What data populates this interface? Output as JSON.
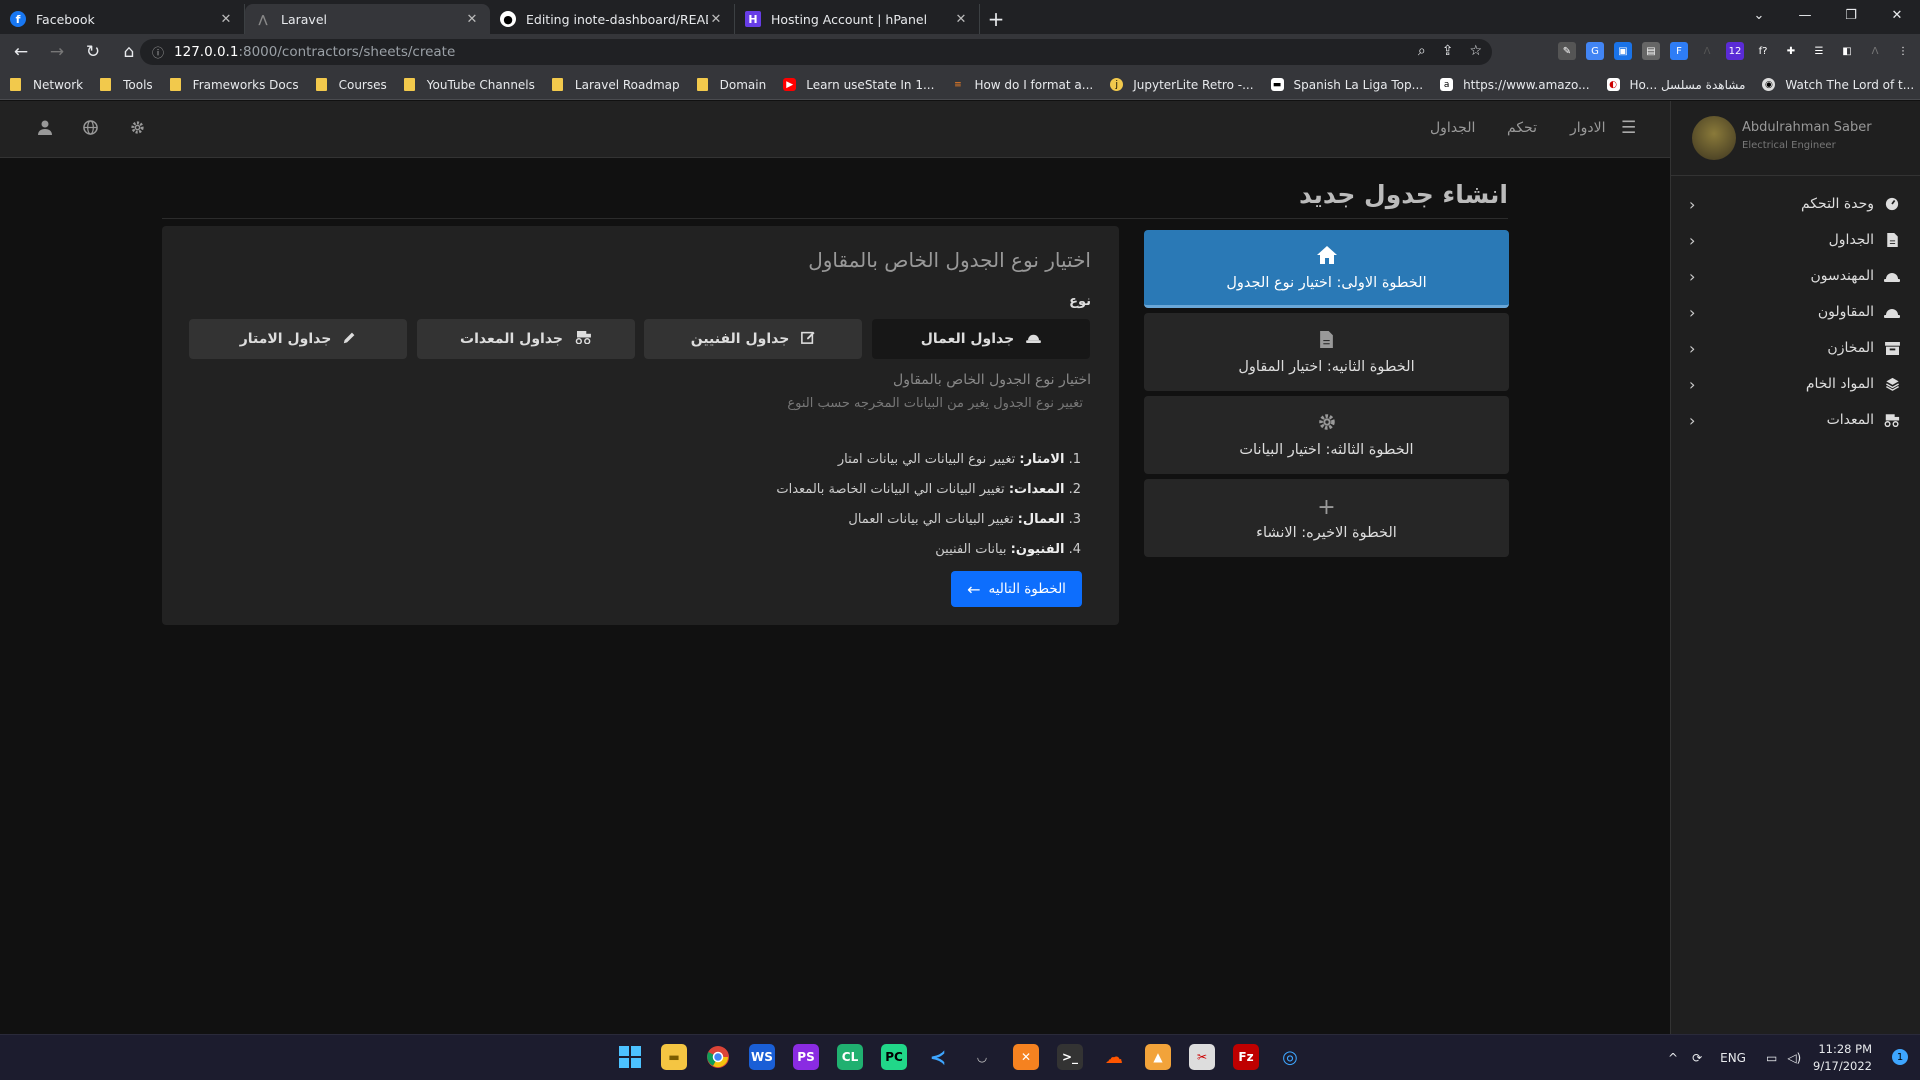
{
  "browser": {
    "tabs": [
      {
        "title": "Facebook",
        "icon": "facebook-icon",
        "color": "#1877f2"
      },
      {
        "title": "Laravel",
        "icon": "laravel-icon",
        "color": "#35363a"
      },
      {
        "title": "Editing inote-dashboard/READM",
        "icon": "github-icon",
        "color": "#ffffff"
      },
      {
        "title": "Hosting Account | hPanel",
        "icon": "hostinger-icon",
        "color": "#673de6"
      }
    ],
    "url_host": "127.0.0.1",
    "url_path": ":8000/contractors/sheets/create",
    "bookmarks": [
      {
        "label": "Network",
        "type": "folder"
      },
      {
        "label": "Tools",
        "type": "folder"
      },
      {
        "label": "Frameworks Docs",
        "type": "folder"
      },
      {
        "label": "Courses",
        "type": "folder"
      },
      {
        "label": "YouTube Channels",
        "type": "folder"
      },
      {
        "label": "Laravel Roadmap",
        "type": "folder"
      },
      {
        "label": "Domain",
        "type": "folder"
      },
      {
        "label": "Learn useState In 1...",
        "type": "youtube"
      },
      {
        "label": "How do I format a...",
        "type": "stackoverflow"
      },
      {
        "label": "JupyterLite Retro -...",
        "type": "jupyter"
      },
      {
        "label": "Spanish La Liga Top...",
        "type": "site"
      },
      {
        "label": "https://www.amazo...",
        "type": "amazon"
      },
      {
        "label": "Ho... مشاهدة مسلسل",
        "type": "site2"
      },
      {
        "label": "Watch The Lord of t...",
        "type": "site3"
      }
    ]
  },
  "header": {
    "nav": [
      "الادوار",
      "تحكم",
      "الجداول"
    ]
  },
  "sidebar": {
    "user_name": "Abdulrahman Saber",
    "user_role": "Electrical Engineer",
    "items": [
      {
        "label": "وحدة التحكم",
        "icon": "dashboard-icon"
      },
      {
        "label": "الجداول",
        "icon": "file-icon"
      },
      {
        "label": "المهندسون",
        "icon": "helmet-icon"
      },
      {
        "label": "المقاولون",
        "icon": "helmet-icon"
      },
      {
        "label": "المخازن",
        "icon": "warehouse-icon"
      },
      {
        "label": "المواد الخام",
        "icon": "layers-icon"
      },
      {
        "label": "المعدات",
        "icon": "truck-icon"
      }
    ]
  },
  "page": {
    "title": "انشاء جدول جديد",
    "steps": [
      {
        "label": "الخطوة الاولى: اختيار نوع الجدول",
        "icon": "home-icon",
        "active": true
      },
      {
        "label": "الخطوة الثانيه: اختيار المقاول",
        "icon": "file-icon",
        "active": false
      },
      {
        "label": "الخطوة الثالثه: اختيار البيانات",
        "icon": "gear-icon",
        "active": false
      },
      {
        "label": "الخطوة الاخيره: الانشاء",
        "icon": "plus-icon",
        "active": false
      }
    ],
    "card_title": "اختيار نوع الجدول الخاص بالمقاول",
    "type_label": "نوع",
    "type_buttons": [
      {
        "label": "جداول العمال",
        "icon": "helmet-icon",
        "selected": true
      },
      {
        "label": "جداول الفنيين",
        "icon": "edit-icon",
        "selected": false
      },
      {
        "label": "جداول المعدات",
        "icon": "truck-icon",
        "selected": false
      },
      {
        "label": "جداول الامتار",
        "icon": "pencil-icon",
        "selected": false
      }
    ],
    "desc_title": "اختيار نوع الجدول الخاص بالمقاول",
    "desc_sub": "تغيير نوع الجدول يغير من البيانات المخرجه حسب النوع",
    "list": [
      {
        "num": "1.",
        "term": "الامتار:",
        "text": "تغيير نوع البيانات الي بيانات امتار"
      },
      {
        "num": "2.",
        "term": "المعدات:",
        "text": "تغيير البيانات الي البيانات الخاصة بالمعدات"
      },
      {
        "num": "3.",
        "term": "العمال:",
        "text": "تغيير البيانات الي بيانات العمال"
      },
      {
        "num": "4.",
        "term": "الفنيون:",
        "text": "بيانات الفنيين"
      }
    ],
    "next_label": "الخطوة التاليه"
  },
  "taskbar": {
    "lang": "ENG",
    "time": "11:28 PM",
    "date": "9/17/2022",
    "notifications": "1"
  }
}
